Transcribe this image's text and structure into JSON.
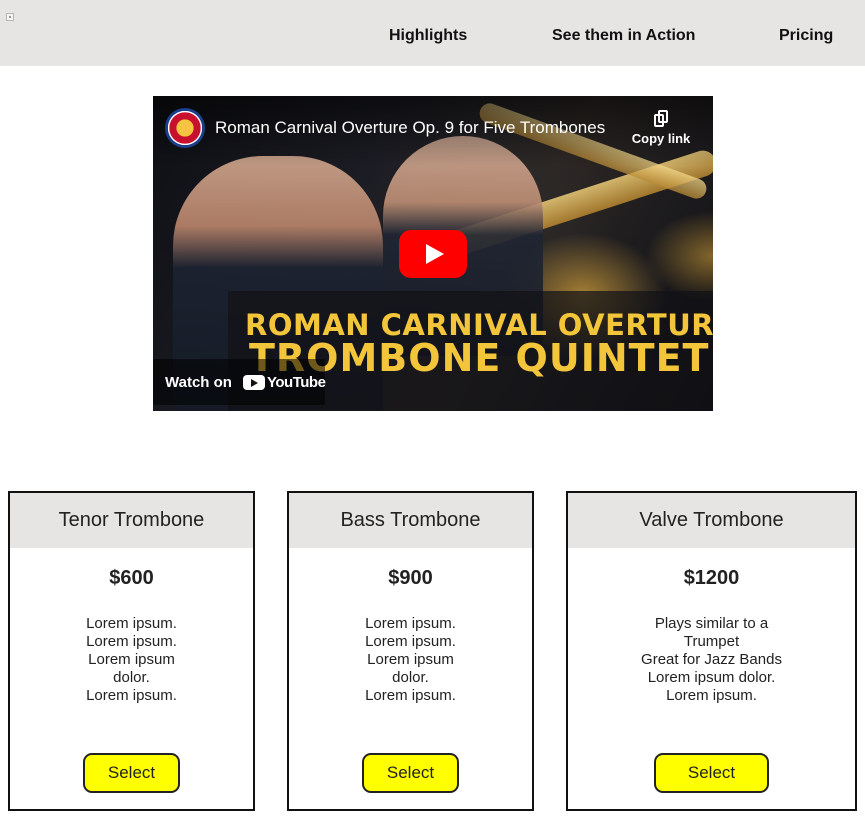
{
  "nav": {
    "links": [
      {
        "label": "Highlights"
      },
      {
        "label": "See them in Action"
      },
      {
        "label": "Pricing"
      }
    ]
  },
  "video": {
    "title": "Roman Carnival Overture Op. 9 for Five Trombones",
    "copy_link_label": "Copy link",
    "banner_line1": "ROMAN CARNIVAL OVERTURE",
    "banner_line2": "TROMBONE QUINTET",
    "watch_on_label": "Watch on",
    "youtube_label": "YouTube",
    "play_color": "#ff0000",
    "banner_color": "#f3c53b"
  },
  "pricing": {
    "accent_button_color": "#ffff00",
    "header_bg": "#e6e5e3",
    "cards": [
      {
        "name": "Tenor Trombone",
        "price": "$600",
        "lines": [
          "Lorem ipsum.",
          "Lorem ipsum.",
          "Lorem ipsum",
          "dolor.",
          "Lorem ipsum."
        ],
        "button_label": "Select"
      },
      {
        "name": "Bass Trombone",
        "price": "$900",
        "lines": [
          "Lorem ipsum.",
          "Lorem ipsum.",
          "Lorem ipsum",
          "dolor.",
          "Lorem ipsum."
        ],
        "button_label": "Select"
      },
      {
        "name": "Valve Trombone",
        "price": "$1200",
        "lines": [
          "Plays similar to a",
          "Trumpet",
          "Great for Jazz Bands",
          "Lorem ipsum dolor.",
          "Lorem ipsum."
        ],
        "button_label": "Select"
      }
    ]
  }
}
